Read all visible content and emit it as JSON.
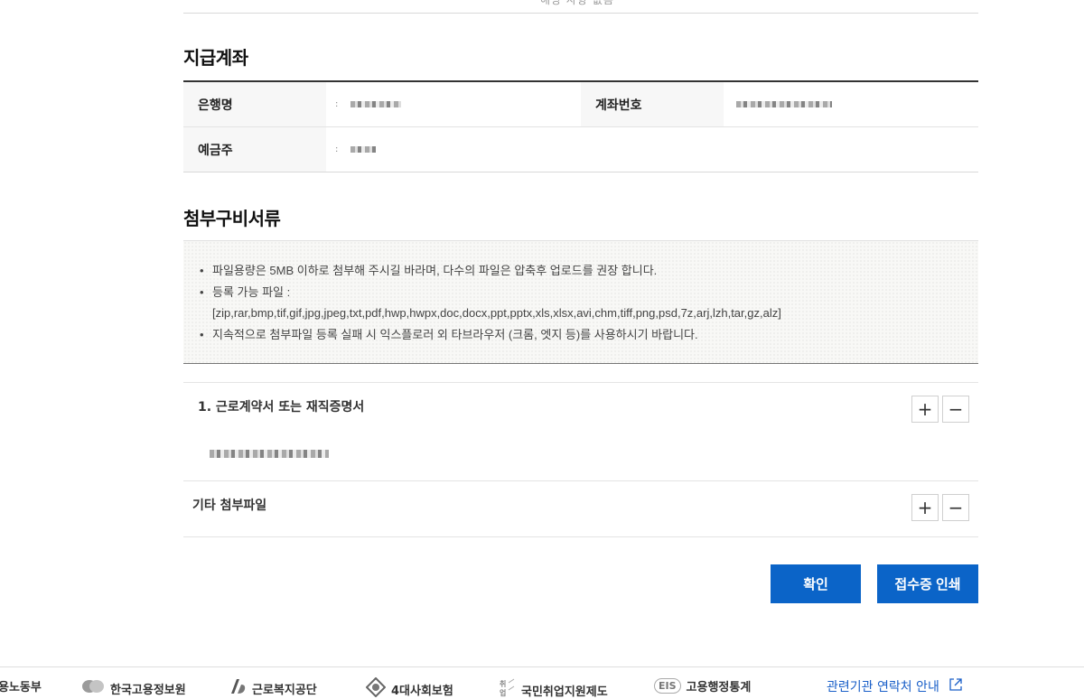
{
  "top": {
    "cut_text": "해당 사항 없음"
  },
  "account": {
    "title": "지급계좌",
    "bank_label": "은행명",
    "account_no_label": "계좌번호",
    "holder_label": "예금주"
  },
  "attachments": {
    "title": "첨부구비서류",
    "notices": [
      "파일용량은 5MB 이하로 첨부해 주시길 바라며, 다수의 파일은 압축후 업로드를 권장 합니다.",
      "등록 가능 파일 :",
      "지속적으로 첨부파일 등록 실패 시 익스플로러 외 타브라우저 (크롬, 엣지 등)를 사용하시기 바랍니다."
    ],
    "extensions": "[zip,rar,bmp,tif,gif,jpg,jpeg,txt,pdf,hwp,hwpx,doc,docx,ppt,pptx,xls,xlsx,avi,chm,tiff,png,psd,7z,arj,lzh,tar,gz,alz]",
    "groups": [
      {
        "label": "1. 근로계약서 또는 재직증명서",
        "add": "+",
        "remove": "−"
      },
      {
        "label": "기타 첨부파일",
        "add": "+",
        "remove": "−"
      }
    ]
  },
  "buttons": {
    "confirm": "확인",
    "print_receipt": "접수증 인쇄"
  },
  "footer": {
    "items": [
      "용노동부",
      "한국고용정보원",
      "근로복지공단",
      "4대사회보험",
      "국민취업지원제도",
      "고용행정통계"
    ],
    "eis_badge": "EIS",
    "related_link": "관련기관 연락처 안내"
  },
  "colors": {
    "primary_button": "#0b64c8",
    "link": "#1a5fc8"
  }
}
